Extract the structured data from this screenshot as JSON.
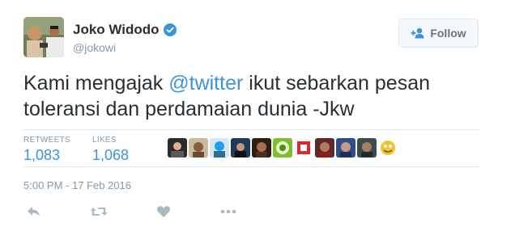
{
  "author": {
    "name": "Joko Widodo",
    "handle": "@jokowi",
    "verified_icon": "verified-badge-icon"
  },
  "follow": {
    "label": "Follow",
    "icon": "add-user-icon"
  },
  "tweet": {
    "text_before": "Kami mengajak ",
    "mention": "@twitter",
    "text_after": " ikut sebarkan pesan toleransi dan perdamaian dunia -Jkw"
  },
  "stats": {
    "retweets_label": "RETWEETS",
    "retweets_value": "1,083",
    "likes_label": "LIKES",
    "likes_value": "1,068"
  },
  "timestamp": "5:00 PM - 17 Feb 2016",
  "actions": [
    "reply-icon",
    "retweet-icon",
    "like-icon",
    "more-icon"
  ],
  "colors": {
    "accent": "#3b94d9",
    "muted": "#8899a6",
    "text": "#292f33",
    "border": "#e1e8ed"
  }
}
